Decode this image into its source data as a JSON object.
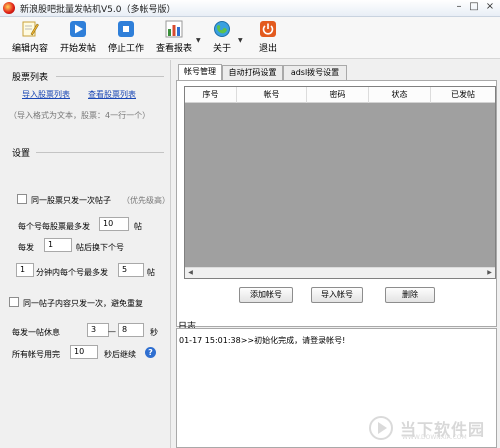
{
  "window": {
    "title": "新浪股吧批量发帖机V5.0（多帐号版）"
  },
  "toolbar": {
    "edit_label": "编辑内容",
    "start_label": "开始发帖",
    "stop_label": "停止工作",
    "report_label": "查看报表",
    "about_label": "关于",
    "exit_label": "退出"
  },
  "stock_list": {
    "heading": "股票列表",
    "import_link": "导入股票列表",
    "view_link": "查看股票列表",
    "hint": "（导入格式为文本，股票：4一行一个）"
  },
  "settings": {
    "heading": "设置",
    "once_per_stock_label": "同一股票只发一次帖子",
    "once_per_stock_note": "（优先级高）",
    "posts_per_account_prefix": "每个号每股票最多发",
    "posts_per_account_value": "10",
    "posts_per_account_suffix": "帖",
    "switch_prefix": "每发",
    "switch_value": "1",
    "switch_suffix": "帖后换下个号",
    "minutes_value": "1",
    "minutes_mid": "分钟内每个号最多发",
    "minutes_posts_value": "5",
    "minutes_suffix": "帖",
    "once_per_content_label": "同一帖子内容只发一次，避免重复",
    "rest_label": "每发一帖休息",
    "rest_min": "3",
    "rest_dash": "—",
    "rest_max": "8",
    "rest_unit": "秒",
    "all_used_label": "所有帐号用完",
    "all_used_value": "10",
    "all_used_suffix": "秒后继续",
    "help_symbol": "?"
  },
  "tabs": [
    {
      "label": "帐号管理"
    },
    {
      "label": "自动打码设置"
    },
    {
      "label": "adsl拨号设置"
    }
  ],
  "accounts_table": {
    "columns": [
      "序号",
      "帐号",
      "密码",
      "状态",
      "已发帖"
    ],
    "rows": []
  },
  "account_buttons": {
    "add": "添加帐号",
    "import": "导入帐号",
    "delete": "删除"
  },
  "log": {
    "heading": "日志",
    "lines": [
      "01-17 15:01:38>>初始化完成，请登录帐号!"
    ]
  },
  "watermark": {
    "text": "当下软件园",
    "url": "WWW.DOWNXIA.COM"
  }
}
